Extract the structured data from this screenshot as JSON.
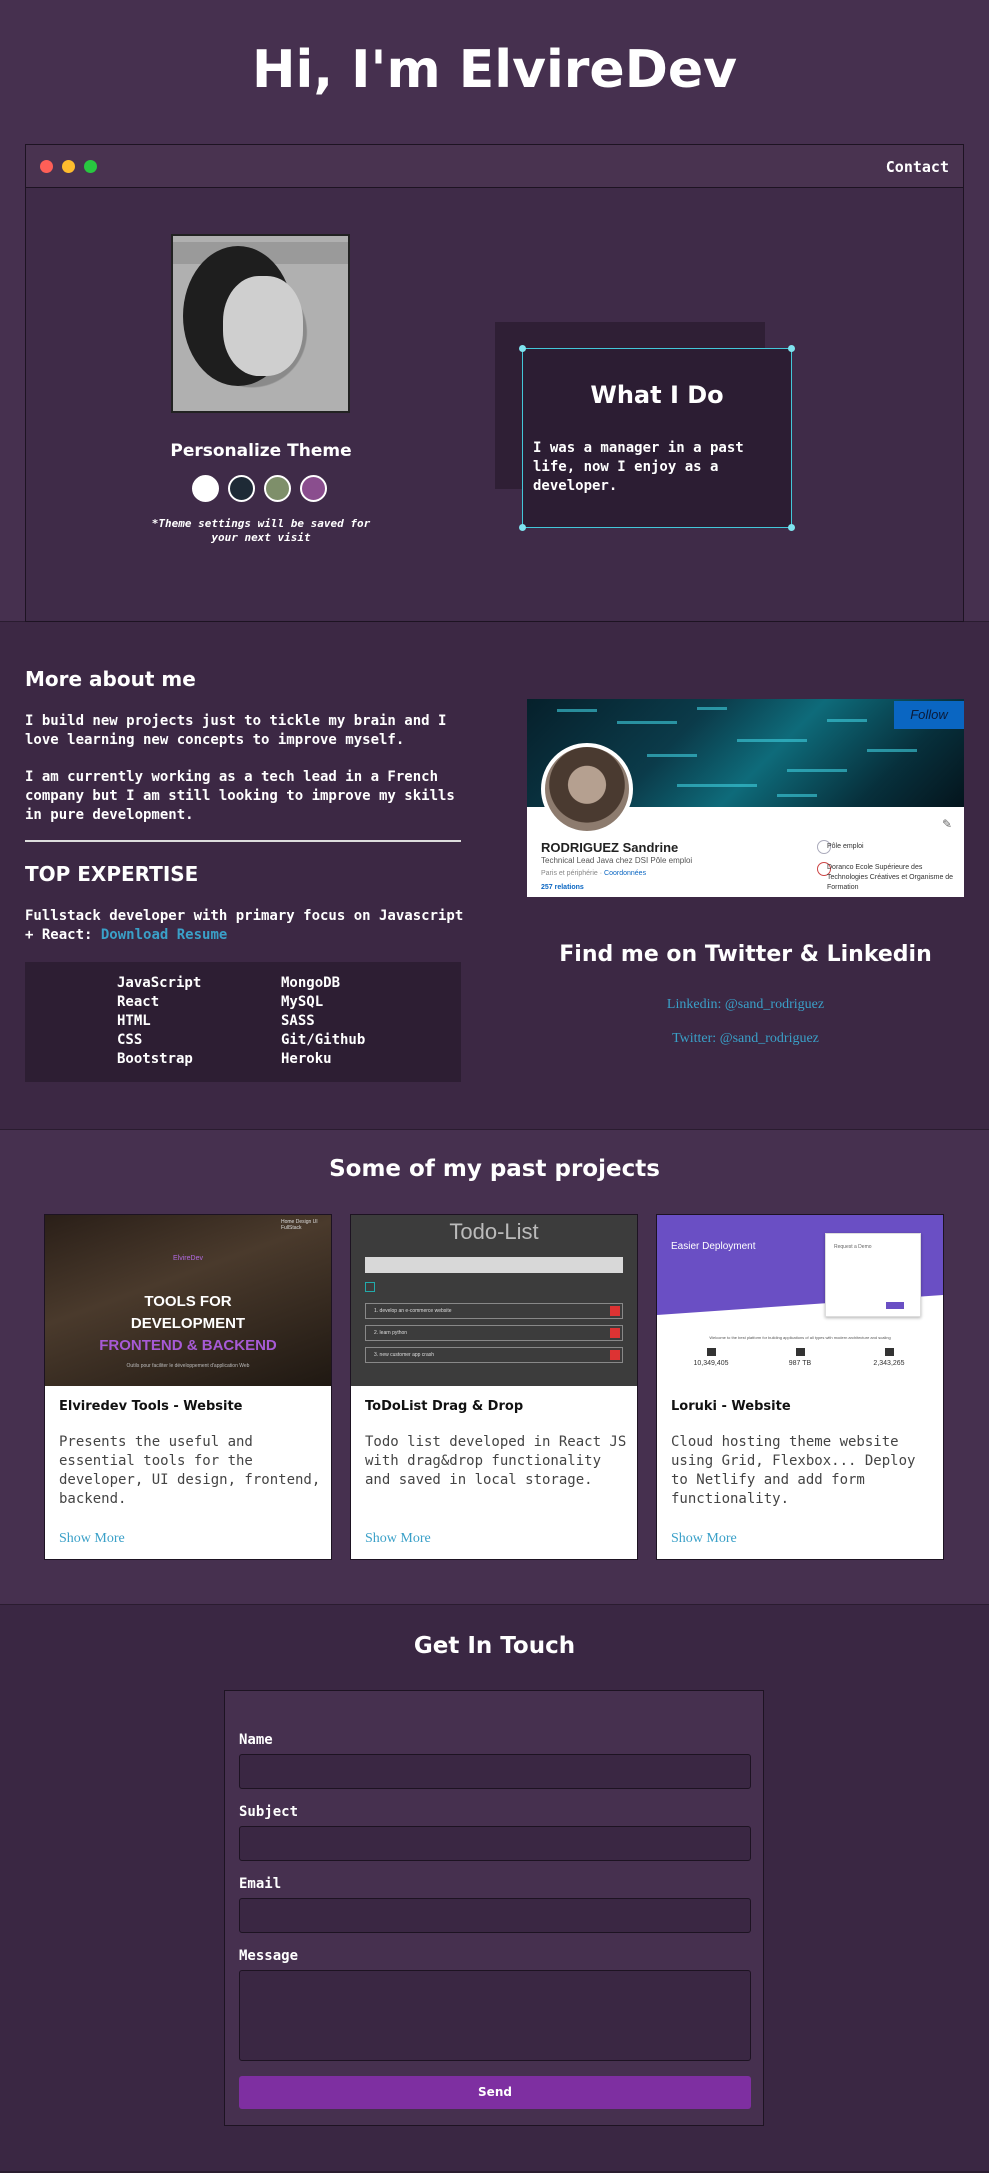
{
  "hero": {
    "title": "Hi, I'm ElvireDev",
    "contact_label": "Contact",
    "theme_title": "Personalize Theme",
    "theme_colors": [
      "#ffffff",
      "#1e2a36",
      "#7e8f6a",
      "#8a4e8e"
    ],
    "theme_note": "*Theme settings will be saved for your next visit",
    "what_title": "What I Do",
    "what_text": "I was a manager in a past life, now I enjoy as a developer."
  },
  "about": {
    "title": "More about me",
    "p1": "I build new projects just to tickle my brain and I love learning new concepts to improve myself.",
    "p2": "I am currently working as a tech lead in a French company but I am still looking to improve my skills in pure development.",
    "expertise_title": "TOP EXPERTISE",
    "expertise_text": "Fullstack developer with primary focus on Javascript + React:",
    "resume_link": "Download Resume",
    "skills_left": [
      "JavaScript",
      "React",
      "HTML",
      "CSS",
      "Bootstrap"
    ],
    "skills_right": [
      "MongoDB",
      "MySQL",
      "SASS",
      "Git/Github",
      "Heroku"
    ]
  },
  "linkedin": {
    "follow": "Follow",
    "name": "RODRIGUEZ Sandrine",
    "headline": "Technical Lead Java chez DSI Pôle emploi",
    "location": "Paris et périphérie ·",
    "coordinates": "Coordonnées",
    "relations": "257 relations",
    "org1": "Pôle emploi",
    "org2": "Doranco Ecole Supérieure des Technologies Créatives et Organisme de Formation"
  },
  "social": {
    "title": "Find me on Twitter & Linkedin",
    "linkedin": "Linkedin: @sand_rodriguez",
    "twitter": "Twitter: @sand_rodriguez"
  },
  "projects": {
    "title": "Some of my past projects",
    "items": [
      {
        "title": "Elviredev Tools - Website",
        "desc": "Presents the useful and essential tools for the developer, UI design, frontend, backend.",
        "more": "Show More",
        "shot_brand": "ElvireDev",
        "shot_nav": "Home   Design UI   FullStack",
        "shot_line1": "TOOLS FOR",
        "shot_line2": "DEVELOPMENT",
        "shot_line3": "FRONTEND & BACKEND",
        "shot_caption": "Outils pour faciliter le développement d'application Web"
      },
      {
        "title": "ToDoList Drag & Drop",
        "desc": "Todo list developed in React JS with drag&drop functionality and saved in local storage.",
        "more": "Show More",
        "shot_title": "Todo-List",
        "shot_tasks": [
          "1. develop an e-commerce website",
          "2. learn python",
          "3. new customer app crash"
        ]
      },
      {
        "title": "Loruki - Website",
        "desc": "Cloud hosting theme website using Grid, Flexbox... Deploy to Netlify and add form functionality.",
        "more": "Show More",
        "shot_title": "Easier Deployment",
        "shot_form_title": "Request a Demo",
        "shot_tagline": "Welcome to the best platform for building applications of all types with modern architecture and scaling",
        "shot_stats": [
          "10,349,405",
          "987 TB",
          "2,343,265"
        ]
      }
    ]
  },
  "contact": {
    "title": "Get In Touch",
    "name_label": "Name",
    "subject_label": "Subject",
    "email_label": "Email",
    "message_label": "Message",
    "send_label": "Send"
  }
}
